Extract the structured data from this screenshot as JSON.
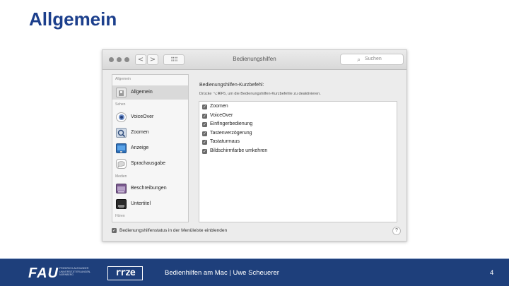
{
  "slide": {
    "title": "Allgemein",
    "page_number": "4"
  },
  "window": {
    "title": "Bedienungshilfen",
    "nav_back": "<",
    "nav_forward": ">",
    "grid_button": "⠿⠿",
    "search_placeholder": "Suchen"
  },
  "sidebar": {
    "sections": {
      "allgemein": "Allgemein",
      "sehen": "Sehen",
      "medien": "Medien",
      "hoeren": "Hören"
    },
    "items": [
      {
        "label": "Allgemein",
        "icon": "accessibility-general-icon",
        "selected": true
      },
      {
        "label": "VoiceOver",
        "icon": "voiceover-icon"
      },
      {
        "label": "Zoomen",
        "icon": "zoom-icon"
      },
      {
        "label": "Anzeige",
        "icon": "display-icon"
      },
      {
        "label": "Sprachausgabe",
        "icon": "speech-icon"
      },
      {
        "label": "Beschreibungen",
        "icon": "descriptions-icon"
      },
      {
        "label": "Untertitel",
        "icon": "captions-icon"
      }
    ]
  },
  "content": {
    "heading": "Bedienungshilfen-Kurzbefehl:",
    "description": "Drücke ⌥⌘F5, um die Bedienungshilfen-Kurzbefehle zu deaktivieren.",
    "options": [
      {
        "label": "Zoomen",
        "checked": true
      },
      {
        "label": "VoiceOver",
        "checked": true
      },
      {
        "label": "Einfingerbedienung",
        "checked": true
      },
      {
        "label": "Tastenverzögerung",
        "checked": true
      },
      {
        "label": "Tastaturmaus",
        "checked": true
      },
      {
        "label": "Bildschirmfarbe umkehren",
        "checked": true
      }
    ],
    "menubar_status_label": "Bedienungshilfenstatus in der Menüleiste einblenden",
    "menubar_status_checked": true,
    "help_label": "?"
  },
  "footer": {
    "fau_logo": "FAU",
    "fau_subtitle": "FRIEDRICH-ALEXANDER UNIVERSITÄT ERLANGEN-NÜRNBERG",
    "mrz_logo": "rrze",
    "text": "Bedienhilfen am Mac | Uwe Scheuerer"
  },
  "colors": {
    "title_blue": "#1c3f8c",
    "footer_blue": "#1e3f7b",
    "checkbox_gray": "#6a6a6a"
  }
}
